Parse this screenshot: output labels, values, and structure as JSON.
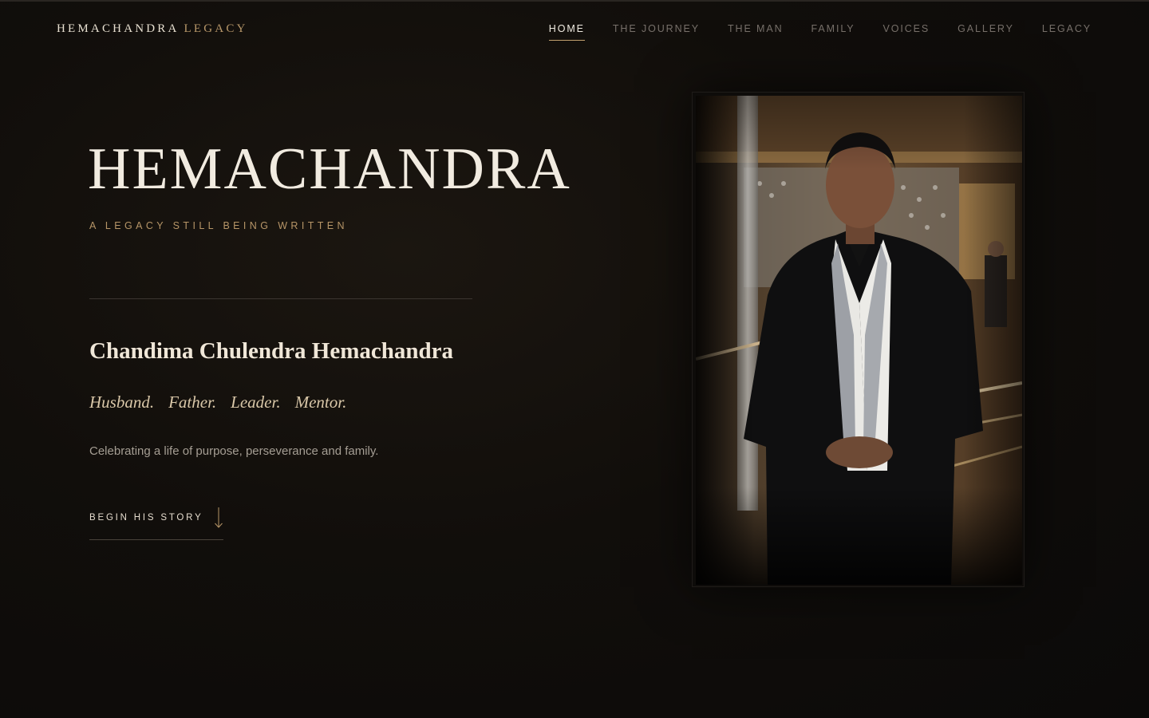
{
  "brand": {
    "name": "HEMACHANDRA",
    "accent": "LEGACY"
  },
  "nav": {
    "items": [
      {
        "label": "HOME",
        "active": true
      },
      {
        "label": "THE JOURNEY",
        "active": false
      },
      {
        "label": "THE MAN",
        "active": false
      },
      {
        "label": "FAMILY",
        "active": false
      },
      {
        "label": "VOICES",
        "active": false
      },
      {
        "label": "GALLERY",
        "active": false
      },
      {
        "label": "LEGACY",
        "active": false
      }
    ]
  },
  "hero": {
    "title": "HEMACHANDRA",
    "tagline": "A LEGACY STILL BEING WRITTEN",
    "full_name": "Chandima Chulendra Hemachandra",
    "roles": [
      "Husband.",
      "Father.",
      "Leader.",
      "Mentor."
    ],
    "intro": "Celebrating a life of purpose, perseverance and family.",
    "cta_label": "BEGIN HIS STORY"
  },
  "portrait": {
    "subject": "portrait-photo"
  },
  "colors": {
    "background": "#0d0b09",
    "accent_gold": "#b69567",
    "text_primary": "#f1ebe0",
    "text_muted": "#a59e94"
  }
}
